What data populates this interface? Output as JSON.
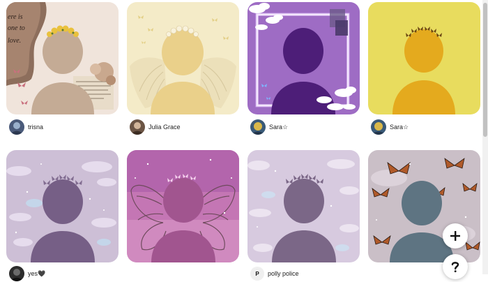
{
  "colors": {
    "background": "#ffffff",
    "text": "#222222",
    "fab_background": "#ffffff",
    "fab_icon": "#111111"
  },
  "pins": [
    {
      "icon": "profile-placeholder-vintage-butterflies",
      "author": "trisna",
      "collage_text": [
        "ere is",
        "one to",
        "love."
      ]
    },
    {
      "icon": "profile-placeholder-angel-wings-yellow",
      "author": "Julia Grace"
    },
    {
      "icon": "profile-placeholder-purple-cloud-frame",
      "author": "Sara☆"
    },
    {
      "icon": "profile-placeholder-yellow-butterfly-crown",
      "author": "Sara☆"
    },
    {
      "icon": "profile-placeholder-lavender-sky",
      "author": "yes🖤"
    },
    {
      "icon": "profile-placeholder-pink-fairy-wings",
      "author": ""
    },
    {
      "icon": "profile-placeholder-lilac-clouds",
      "author": "polly police",
      "avatar_letter": "P"
    },
    {
      "icon": "profile-placeholder-monarch-butterflies",
      "author": ""
    }
  ],
  "fab": {
    "create_icon": "plus-icon",
    "create_label": "+",
    "help_icon": "question-icon",
    "help_label": "?"
  }
}
